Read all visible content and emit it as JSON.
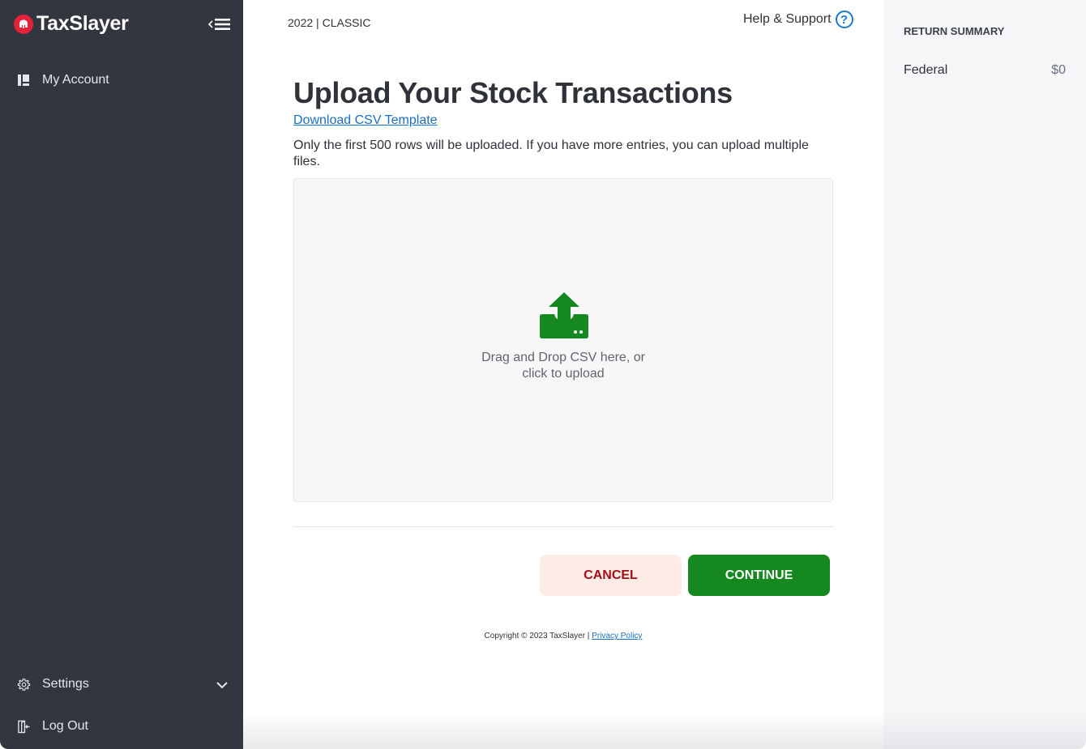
{
  "app": {
    "brand_name": "TaxSlayer"
  },
  "sidebar": {
    "items": [
      {
        "label": "My Account",
        "icon": "account-icon"
      },
      {
        "label": "Settings",
        "icon": "gear-icon",
        "expandable": true
      },
      {
        "label": "Log Out",
        "icon": "logout-icon"
      }
    ]
  },
  "header": {
    "year": "2022",
    "separator": " | ",
    "edition": "CLASSIC",
    "help_label": "Help & Support",
    "help_icon_glyph": "?"
  },
  "main": {
    "title": "Upload Your Stock Transactions",
    "download_link": "Download CSV Template",
    "note": "Only the first 500 rows will be uploaded. If you have more entries, you can upload multiple files.",
    "dropzone": {
      "line1": "Drag and Drop CSV here, or",
      "line2": "click to upload",
      "icon": "upload-icon"
    },
    "buttons": {
      "cancel": "CANCEL",
      "continue": "CONTINUE"
    }
  },
  "footer": {
    "copyright": "Copyright © 2023 TaxSlayer | ",
    "privacy_link": "Privacy Policy"
  },
  "summary": {
    "title": "RETURN SUMMARY",
    "rows": [
      {
        "label": "Federal",
        "value": "$0"
      }
    ]
  },
  "colors": {
    "brand_red": "#e2233a",
    "sidebar_bg": "#33363f",
    "link_blue": "#1a6fc4",
    "continue_green": "#168820",
    "cancel_bg": "#fdebe6",
    "cancel_text": "#a30e16"
  }
}
